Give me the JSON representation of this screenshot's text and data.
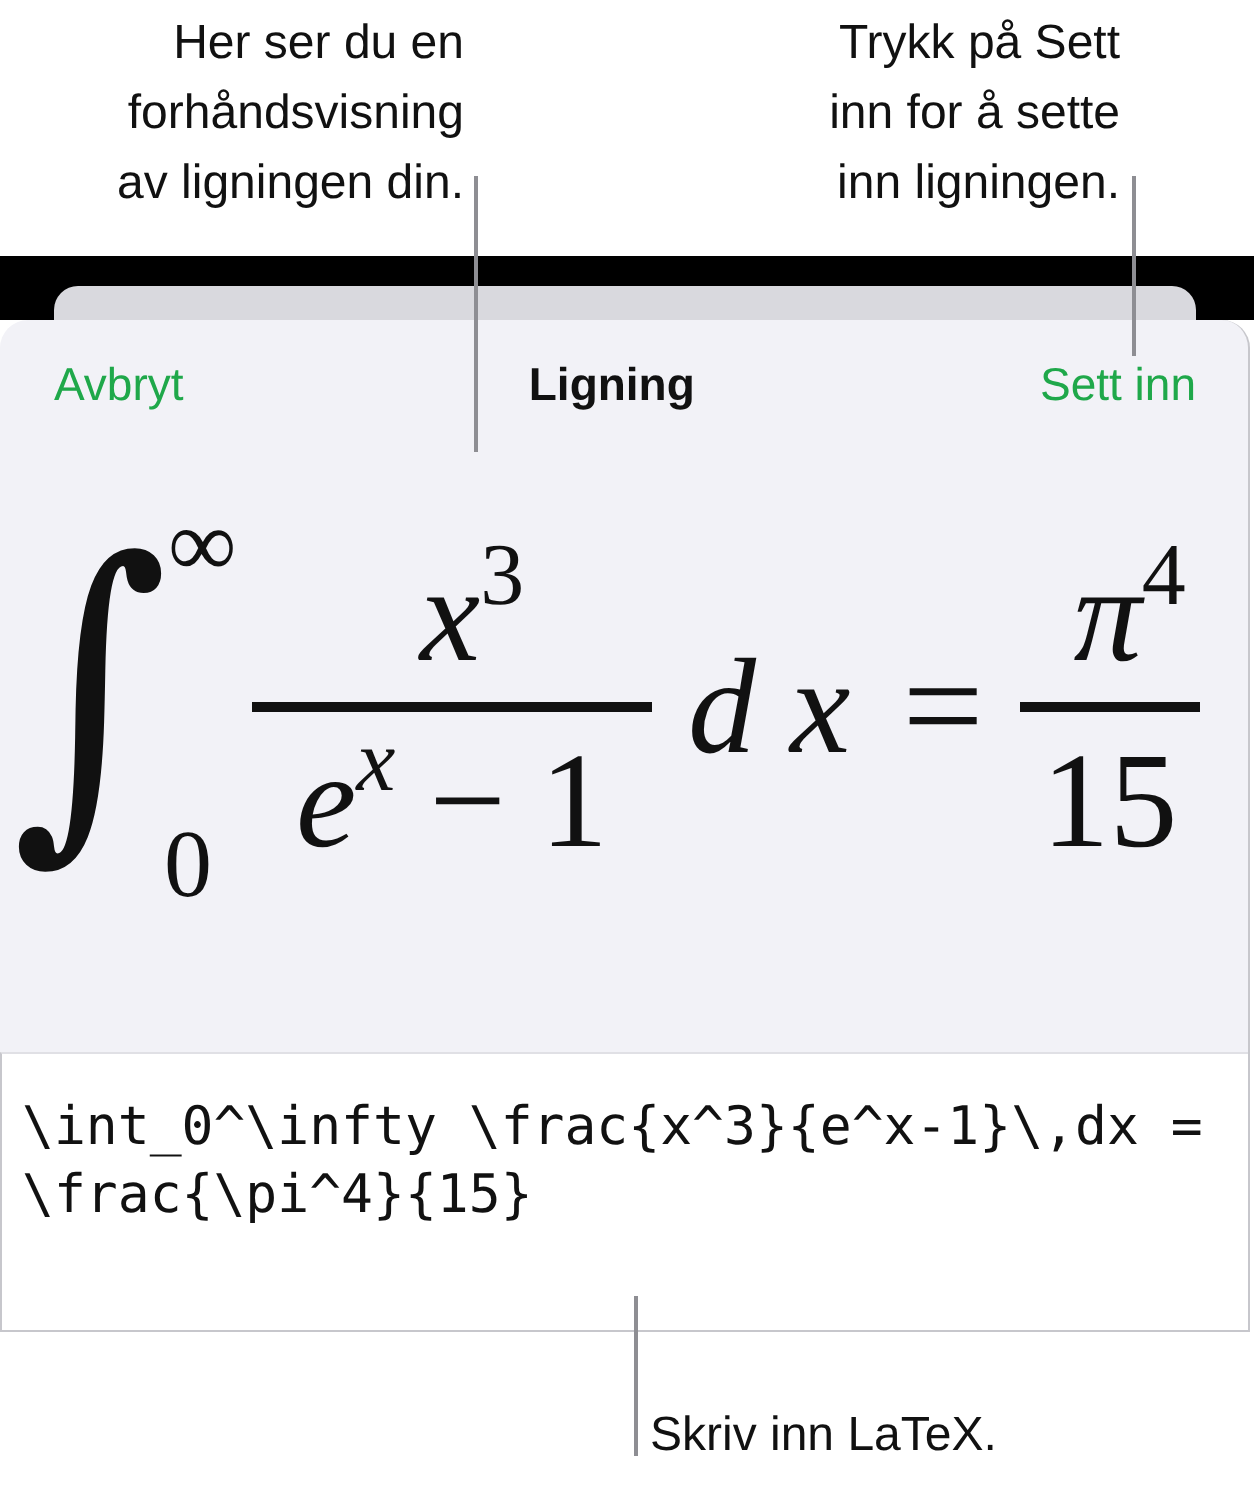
{
  "callouts": [
    {
      "lines": [
        "Her ser du en",
        "forhåndsvisning",
        "av ligningen din."
      ]
    },
    {
      "lines": [
        "Trykk på Sett",
        "inn for å sette",
        "inn ligningen."
      ]
    }
  ],
  "sheet": {
    "cancel": "Avbryt",
    "title": "Ligning",
    "insert": "Sett inn"
  },
  "equation": {
    "integral": "∫",
    "lower": "0",
    "upper": "∞",
    "numerator": "x",
    "numerator_exponent": "3",
    "denominator_base": "e",
    "denominator_exponent": "x",
    "denominator_rest": "− 1",
    "differential": "d x",
    "equals": "=",
    "rhs_numerator": "π",
    "rhs_exponent": "4",
    "rhs_denominator": "15"
  },
  "latex": {
    "value": "\\int_0^\\infty \\frac{x^3}{e^x-1}\\,dx = \\frac{\\pi^4}{15}"
  },
  "bottom_callout": {
    "text": "Skriv inn LaTeX."
  }
}
